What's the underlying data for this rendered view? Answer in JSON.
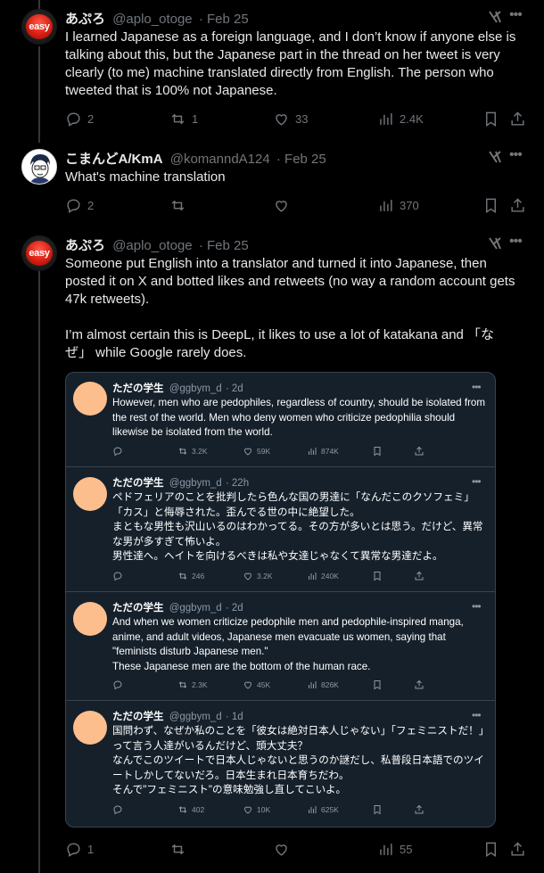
{
  "posts": [
    {
      "name": "あぷろ",
      "handle": "@aplo_otoge",
      "date": "· Feb 25",
      "avatar_text": "easy",
      "text": "I learned Japanese as a foreign language, and I don’t know if anyone else is talking about this, but the Japanese part in the thread on her tweet is very clearly (to me) machine translated directly from English. The person who tweeted that is 100% not Japanese.",
      "replies": "2",
      "reposts": "1",
      "likes": "33",
      "views": "2.4K"
    },
    {
      "name": "こまんどA/KmA",
      "handle": "@komanndA124",
      "date": "· Feb 25",
      "text": "What's machine translation",
      "replies": "2",
      "reposts": "",
      "likes": "",
      "views": "370"
    },
    {
      "name": "あぷろ",
      "handle": "@aplo_otoge",
      "date": "· Feb 25",
      "avatar_text": "easy",
      "text": "Someone put English into a translator and turned it into Japanese, then posted it on X and botted likes and retweets (no way a random account gets 47k retweets).\n\nI’m almost certain this is DeepL, it likes to use a lot of katakana and 「なぜ」 while Google rarely does.",
      "replies": "1",
      "reposts": "",
      "likes": "",
      "views": "55"
    }
  ],
  "embedded": [
    {
      "name": "ただの学生",
      "handle": "@ggbym_d",
      "date": "· 2d",
      "text": "However, men who are pedophiles, regardless of country, should be isolated from the rest of the world. Men who deny women who criticize pedophilia should likewise be isolated from the world.",
      "replies": "",
      "reposts": "3.2K",
      "likes": "59K",
      "views": "874K"
    },
    {
      "name": "ただの学生",
      "handle": "@ggbym_d",
      "date": "· 22h",
      "text": "ペドフェリアのことを批判したら色んな国の男達に「なんだこのクソフェミ」「カス」と侮辱された。歪んでる世の中に絶望した。\nまともな男性も沢山いるのはわかってる。その方が多いとは思う。だけど、異常な男が多すぎて怖いよ。\n男性達へ。ヘイトを向けるべきは私や女達じゃなくて異常な男達だよ。",
      "replies": "",
      "reposts": "246",
      "likes": "3.2K",
      "views": "240K"
    },
    {
      "name": "ただの学生",
      "handle": "@ggbym_d",
      "date": "· 2d",
      "text": "And when we women criticize pedophile men and pedophile-inspired manga, anime, and adult videos, Japanese men evacuate us women, saying that \"feminists disturb Japanese men.\"\nThese Japanese men are the bottom of the human race.",
      "replies": "",
      "reposts": "2.3K",
      "likes": "45K",
      "views": "826K"
    },
    {
      "name": "ただの学生",
      "handle": "@ggbym_d",
      "date": "· 1d",
      "text": "国問わず、なぜか私のことを「彼女は絶対日本人じゃない」「フェミニストだ！」って言う人達がいるんだけど、頭大丈夫？\nなんでこのツイートで日本人じゃないと思うのか謎だし、私普段日本語でのツイートしかしてないだろ。日本生まれ日本育ちだわ。\nそんで\"フェミニスト\"の意味勉強し直してこいよ。",
      "replies": "",
      "reposts": "402",
      "likes": "10K",
      "views": "625K"
    }
  ],
  "colors": {
    "background": "#000000",
    "text": "#e7e9ea",
    "muted": "#71767b",
    "card_bg": "#15202b",
    "card_border": "#38444d",
    "card_avatar": "#fdbe8d"
  },
  "icons": [
    "reply-icon",
    "repost-icon",
    "like-icon",
    "views-icon",
    "bookmark-icon",
    "share-icon",
    "grok-icon",
    "more-icon"
  ]
}
